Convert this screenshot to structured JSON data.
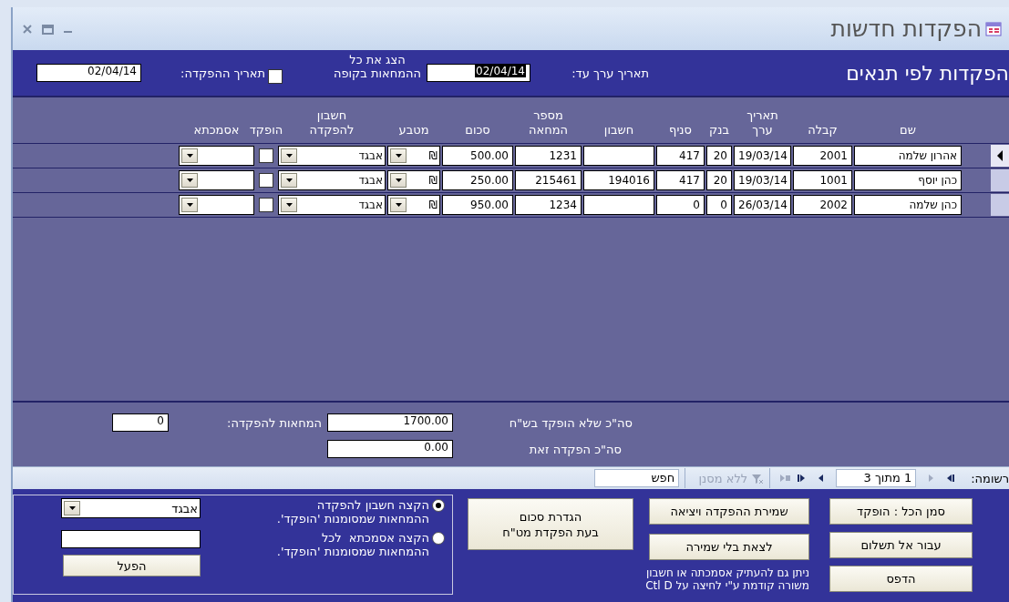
{
  "window": {
    "title": "הפקדות חדשות"
  },
  "header": {
    "title": "הפקדות לפי תנאים",
    "value_date_label": "תאריך ערך עד:",
    "value_date": "02/04/14",
    "value_date_selected": true,
    "show_all_label": "הצג את כל\nההמחאות בקופה",
    "deposit_date_label": "תאריך ההפקדה:",
    "deposit_date_checked": false,
    "deposit_date": "02/04/14"
  },
  "table": {
    "columns": [
      "שם",
      "קבלה",
      "תאריך\nערך",
      "בנק",
      "סניף",
      "חשבון",
      "מספר\nהמחאה",
      "סכום",
      "מטבע",
      "חשבון\nלהפקדה",
      "הופקד",
      "אסמכתא"
    ],
    "rows": [
      {
        "current": true,
        "name": "אהרון שלמה",
        "receipt": "2001",
        "value_date": "19/03/14",
        "bank": "20",
        "branch": "417",
        "account": "",
        "check_no": "1231",
        "amount": "500.00",
        "currency": "₪",
        "deposit_account": "אבגד",
        "deposited": false
      },
      {
        "current": false,
        "name": "כהן יוסף",
        "receipt": "1001",
        "value_date": "19/03/14",
        "bank": "20",
        "branch": "417",
        "account": "194016",
        "check_no": "215461",
        "amount": "250.00",
        "currency": "₪",
        "deposit_account": "אבגד",
        "deposited": false
      },
      {
        "current": false,
        "name": "כהן שלמה",
        "receipt": "2002",
        "value_date": "26/03/14",
        "bank": "0",
        "branch": "0",
        "account": "",
        "check_no": "1234",
        "amount": "950.00",
        "currency": "₪",
        "deposit_account": "אבגד",
        "deposited": false
      }
    ]
  },
  "totals": {
    "not_deposited_label": "סה\"כ שלא הופקד בש\"ח",
    "not_deposited": "1700.00",
    "checks_label": "המחאות להפקדה:",
    "checks": "0",
    "this_deposit_label": "סה\"כ הפקדה זאת",
    "this_deposit": "0.00"
  },
  "navigation": {
    "record_label": "רשומה:",
    "position": "1 מתוך 3",
    "filter": "ללא מסנן",
    "search": "חפש"
  },
  "buttons": [
    {
      "label": "סמן הכל : הופקד"
    },
    {
      "label": "עבור אל תשלום"
    },
    {
      "label": "הדפס"
    },
    {
      "label": "שמירת ההפקדה ויציאה"
    },
    {
      "label": "לצאת בלי שמירה"
    },
    {
      "label": "הגדרת סכום\nבעת הפקדת מט\"ח"
    }
  ],
  "note": "ניתן גם להעתיק אסמכתה או חשבון\nמשורה קודמת ע\"י לחיצה על Ctl D",
  "assign": {
    "options": [
      {
        "label": "הקצה חשבון להפקדה\nההמחאות שמסומנות 'הופקד'.",
        "selected": true
      },
      {
        "label": "הקצה אסמכתא  לכל\nההמחאות שמסומנות 'הופקד'.",
        "selected": false
      }
    ],
    "account": "אבגד",
    "apply": "הפעל"
  }
}
